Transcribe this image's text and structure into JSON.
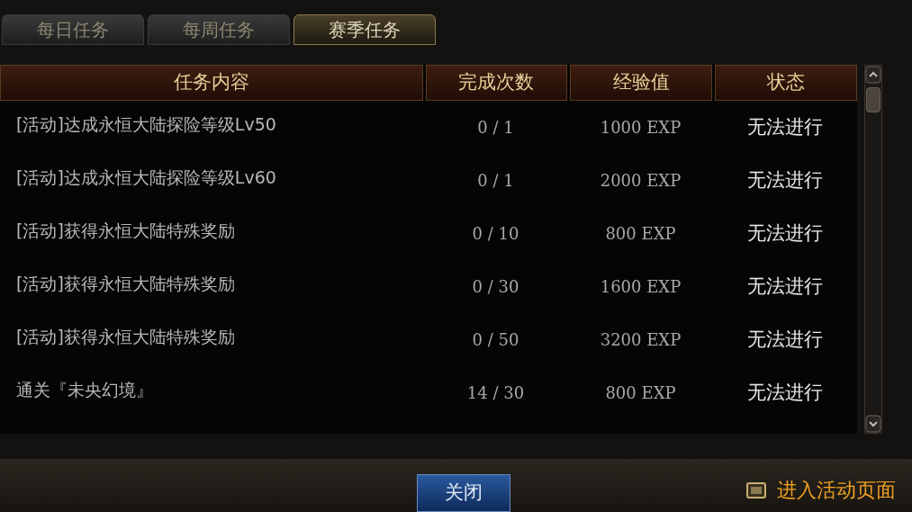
{
  "tabs": [
    {
      "label": "每日任务",
      "selected": false
    },
    {
      "label": "每周任务",
      "selected": false
    },
    {
      "label": "赛季任务",
      "selected": true
    }
  ],
  "table": {
    "columns": [
      "任务内容",
      "完成次数",
      "经验值",
      "状态"
    ],
    "rows": [
      {
        "task": "[活动]达成永恒大陆探险等级Lv50",
        "count": "0 / 1",
        "exp": "1000 EXP",
        "status": "无法进行"
      },
      {
        "task": "[活动]达成永恒大陆探险等级Lv60",
        "count": "0 / 1",
        "exp": "2000 EXP",
        "status": "无法进行"
      },
      {
        "task": "[活动]获得永恒大陆特殊奖励",
        "count": "0 / 10",
        "exp": "800 EXP",
        "status": "无法进行"
      },
      {
        "task": "[活动]获得永恒大陆特殊奖励",
        "count": "0 / 30",
        "exp": "1600 EXP",
        "status": "无法进行"
      },
      {
        "task": "[活动]获得永恒大陆特殊奖励",
        "count": "0 / 50",
        "exp": "3200 EXP",
        "status": "无法进行"
      },
      {
        "task": "通关『未央幻境』",
        "count": "14 / 30",
        "exp": "800 EXP",
        "status": "无法进行"
      }
    ]
  },
  "close_button": "关闭",
  "event_link": "进入活动页面"
}
